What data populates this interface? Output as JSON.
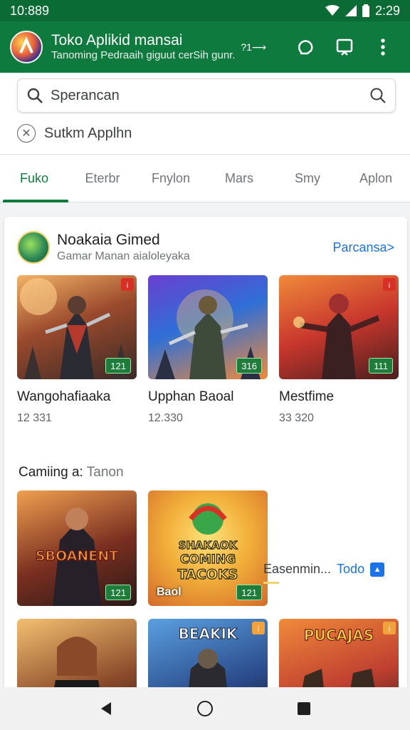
{
  "status": {
    "time": "10:889",
    "clock": "2:29"
  },
  "appbar": {
    "title": "Toko Aplikid mansai",
    "subtitle": "Tanoming Pedraaih giguut cerSih gunr.",
    "arrow": "?1⟶",
    "logo_icon": "app-logo-icon",
    "icons": [
      "refresh-icon",
      "screen-icon",
      "more-vert-icon"
    ]
  },
  "search": {
    "text": "Sperancan",
    "suggestion": "Sutkm Applhn"
  },
  "tabs": [
    {
      "label": "Fuko",
      "active": true
    },
    {
      "label": "Eterbr",
      "active": false
    },
    {
      "label": "Fnylon",
      "active": false
    },
    {
      "label": "Mars",
      "active": false
    },
    {
      "label": "Smy",
      "active": false
    },
    {
      "label": "Aplon",
      "active": false
    }
  ],
  "section1": {
    "title": "Noakaia Gimed",
    "subtitle": "Gamar Manan aialoleyaka",
    "more": "Parcansa>",
    "games": [
      {
        "name": "Wangohafiaaka",
        "count": "12 331",
        "rating": "121"
      },
      {
        "name": "Upphan Baoal",
        "count": "12.330",
        "rating": "316"
      },
      {
        "name": "Mestfime",
        "count": "33 320",
        "rating": "111"
      }
    ]
  },
  "section2": {
    "title": "Camiing a:",
    "title_muted": "Tanon",
    "tiles": [
      {
        "text": "SBOANENT",
        "rating": "121"
      },
      {
        "text": "SHAKAOK COMING TACOKS",
        "caption": "Baol",
        "rating": "121"
      }
    ],
    "suggestion": "Easenmin...",
    "suggestion_link": "Todo",
    "bottom_tiles": [
      "BEAKIK",
      "PUCAJAS"
    ]
  },
  "colors": {
    "primary": "#0f7a3d",
    "accent": "#1a73e8",
    "badge": "#1e7d3a"
  }
}
